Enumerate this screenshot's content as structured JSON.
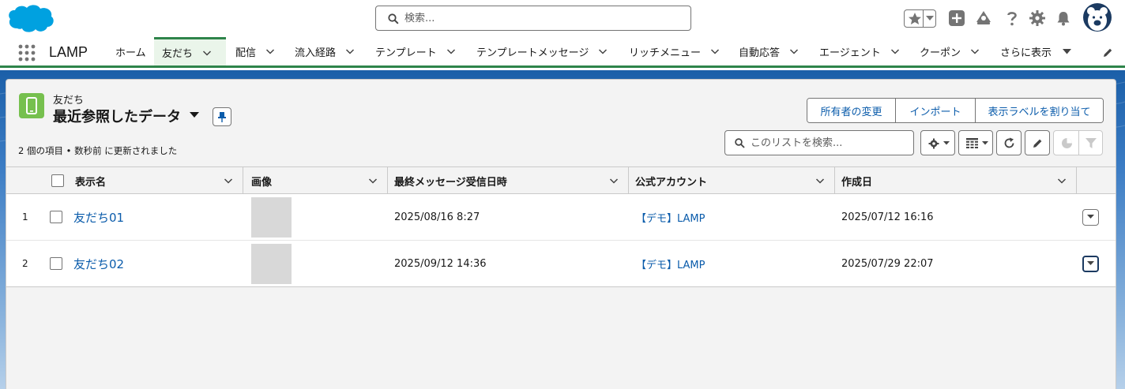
{
  "header": {
    "search_placeholder": "検索..."
  },
  "nav": {
    "app_name": "LAMP",
    "tabs": [
      {
        "label": "ホーム"
      },
      {
        "label": "友だち"
      },
      {
        "label": "配信"
      },
      {
        "label": "流入経路"
      },
      {
        "label": "テンプレート"
      },
      {
        "label": "テンプレートメッセージ"
      },
      {
        "label": "リッチメニュー"
      },
      {
        "label": "自動応答"
      },
      {
        "label": "エージェント"
      },
      {
        "label": "クーポン"
      },
      {
        "label": "さらに表示"
      }
    ],
    "active_tab": "友だち"
  },
  "list": {
    "object_label": "友だち",
    "view_name": "最近参照したデータ",
    "info": "2 個の項目 • 数秒前 に更新されました",
    "actions": {
      "change_owner": "所有者の変更",
      "import": "インポート",
      "assign_label": "表示ラベルを割り当て"
    },
    "search_placeholder": "このリストを検索..."
  },
  "table": {
    "columns": [
      "表示名",
      "画像",
      "最終メッセージ受信日時",
      "公式アカウント",
      "作成日"
    ],
    "rows": [
      {
        "num": "1",
        "name": "友だち01",
        "last_message": "2025/08/16 8:27",
        "account": "【デモ】LAMP",
        "created": "2025/07/12 16:16"
      },
      {
        "num": "2",
        "name": "友だち02",
        "last_message": "2025/09/12 14:36",
        "account": "【デモ】LAMP",
        "created": "2025/07/29 22:07"
      }
    ]
  },
  "colors": {
    "brand_blue": "#00a1e0",
    "link": "#0b5cab",
    "nav_active_border": "#2e844a",
    "object_icon": "#76c04e"
  }
}
